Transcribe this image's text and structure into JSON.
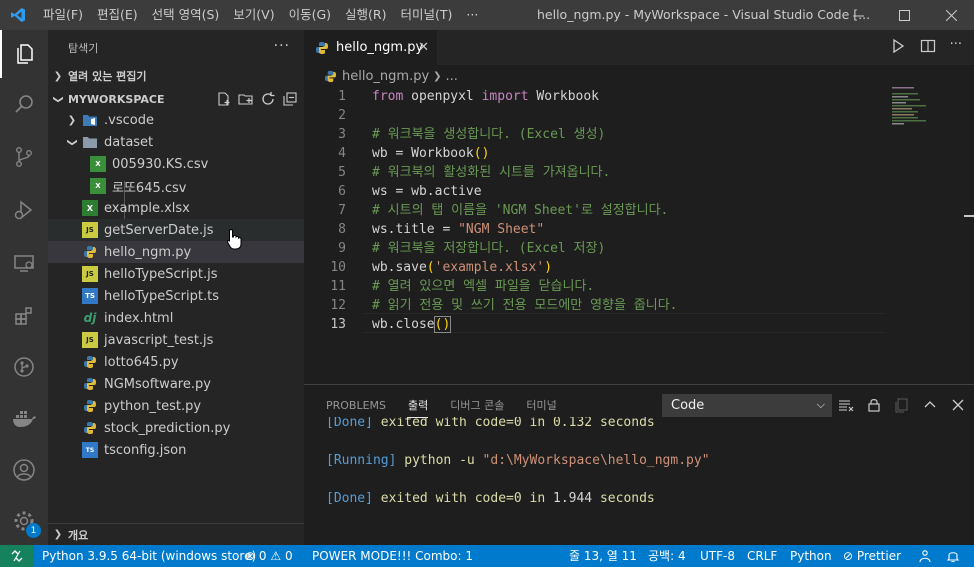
{
  "window": {
    "title": "hello_ngm.py - MyWorkspace - Visual Studio Code [...",
    "menu": [
      "파일(F)",
      "편집(E)",
      "선택 영역(S)",
      "보기(V)",
      "이동(G)",
      "실행(R)",
      "터미널(T)",
      "···"
    ]
  },
  "activity_bar": {
    "items": [
      "explorer-icon",
      "search-icon",
      "source-control-icon",
      "run-debug-icon",
      "remote-explorer-icon",
      "extensions-icon",
      "git-graph-icon",
      "docker-icon",
      "accounts-icon",
      "manage-gear-icon"
    ],
    "manage_badge": "1"
  },
  "sidebar": {
    "header": "탐색기",
    "more": "···",
    "open_editors": "열려 있는 편집기",
    "workspace": "MYWORKSPACE",
    "outline": "개요",
    "tree": [
      {
        "label": ".vscode",
        "icon": "vscode-folder-icon"
      },
      {
        "label": "dataset",
        "icon": "folder-icon"
      },
      {
        "label": "005930.KS.csv",
        "icon": "csv-file-icon"
      },
      {
        "label": "로또645.csv",
        "icon": "csv-file-icon"
      },
      {
        "label": "example.xlsx",
        "icon": "excel-file-icon"
      },
      {
        "label": "getServerDate.js",
        "icon": "js-file-icon"
      },
      {
        "label": "hello_ngm.py",
        "icon": "python-file-icon"
      },
      {
        "label": "helloTypeScript.js",
        "icon": "js-file-icon"
      },
      {
        "label": "helloTypeScript.ts",
        "icon": "ts-file-icon"
      },
      {
        "label": "index.html",
        "icon": "django-file-icon"
      },
      {
        "label": "javascript_test.js",
        "icon": "js-file-icon"
      },
      {
        "label": "lotto645.py",
        "icon": "python-file-icon"
      },
      {
        "label": "NGMsoftware.py",
        "icon": "python-file-icon"
      },
      {
        "label": "python_test.py",
        "icon": "python-file-icon"
      },
      {
        "label": "stock_prediction.py",
        "icon": "python-file-icon"
      },
      {
        "label": "tsconfig.json",
        "icon": "tsconfig-file-icon"
      }
    ]
  },
  "editor": {
    "tab": "hello_ngm.py",
    "breadcrumb": "hello_ngm.py",
    "breadcrumb_more": "...",
    "line_numbers": [
      "1",
      "2",
      "3",
      "4",
      "5",
      "6",
      "7",
      "8",
      "9",
      "10",
      "11",
      "12",
      "13"
    ],
    "code": {
      "l1": [
        "from",
        " openpyxl ",
        "import",
        " Workbook"
      ],
      "l3": "# 워크북을 생성합니다. (Excel 생성)",
      "l4": [
        "wb",
        " = ",
        "Workbook",
        "()"
      ],
      "l5": "# 워크북의 활성화된 시트를 가져옵니다.",
      "l6": [
        "ws",
        " = ",
        "wb",
        ".",
        "active"
      ],
      "l7": "# 시트의 탭 이름을 'NGM Sheet'로 설정합니다.",
      "l8": [
        "ws",
        ".",
        "title",
        " = ",
        "\"NGM Sheet\""
      ],
      "l9": "# 워크북을 저장합니다. (Excel 저장)",
      "l10": [
        "wb",
        ".",
        "save",
        "(",
        "'example.xlsx'",
        ")"
      ],
      "l11": "# 열려 있으면 엑셀 파일을 닫습니다.",
      "l12": "# 읽기 전용 및 쓰기 전용 모드에만 영향을 줍니다.",
      "l13": [
        "wb",
        ".",
        "close",
        "()"
      ]
    }
  },
  "panel": {
    "tabs": [
      "PROBLEMS",
      "출력",
      "디버그 콘솔",
      "터미널"
    ],
    "active_tab": "출력",
    "select_value": "Code",
    "output": {
      "line0_done": "[Done]",
      "line0_rest": " exited with code=0 in 0.132 seconds",
      "line1_running": "[Running]",
      "line1_cmd": " python -u ",
      "line1_path": "\"d:\\MyWorkspace\\hello_ngm.py\"",
      "line2_done": "[Done]",
      "line2_text1": " exited with ",
      "line2_code": "code=0",
      "line2_text2": " in ",
      "line2_num": "1.944",
      "line2_text3": " seconds"
    }
  },
  "status_bar": {
    "python": "Python 3.9.5 64-bit (windows store)",
    "errors": "0",
    "warnings": "0",
    "power_mode": "POWER MODE!!! Combo: 1",
    "position": "줄 13, 열 11",
    "spaces": "공백: 4",
    "encoding": "UTF-8",
    "eol": "CRLF",
    "language": "Python",
    "prettier": "Prettier"
  }
}
